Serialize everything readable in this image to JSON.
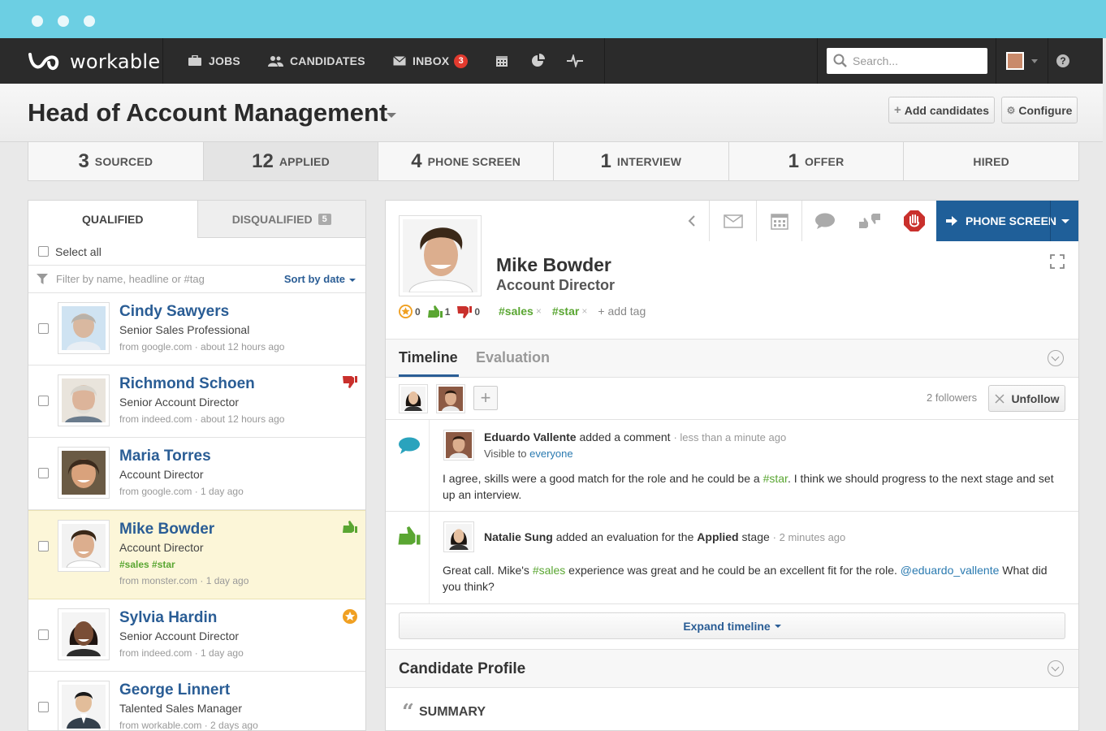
{
  "app": {
    "logo_text": "workable"
  },
  "nav": {
    "jobs": "JOBS",
    "candidates": "CANDIDATES",
    "inbox": "INBOX",
    "inbox_count": "3",
    "search_placeholder": "Search...",
    "help": "?"
  },
  "header": {
    "title": "Head of Account Management",
    "add_candidates": "Add candidates",
    "configure": "Configure"
  },
  "stages": [
    {
      "count": "3",
      "label": "SOURCED"
    },
    {
      "count": "12",
      "label": "APPLIED"
    },
    {
      "count": "4",
      "label": "PHONE SCREEN"
    },
    {
      "count": "1",
      "label": "INTERVIEW"
    },
    {
      "count": "1",
      "label": "OFFER"
    },
    {
      "count": "",
      "label": "HIRED"
    }
  ],
  "list": {
    "tab_qualified": "QUALIFIED",
    "tab_disqualified": "DISQUALIFIED",
    "disqualified_count": "5",
    "select_all": "Select all",
    "filter_placeholder": "Filter by name, headline or #tag",
    "sort": "Sort by date",
    "candidates": [
      {
        "name": "Cindy Sawyers",
        "role": "Senior Sales Professional",
        "meta": "from google.com · about 12 hours ago"
      },
      {
        "name": "Richmond Schoen",
        "role": "Senior Account Director",
        "meta": "from indeed.com · about 12 hours ago"
      },
      {
        "name": "Maria Torres",
        "role": "Account Director",
        "meta": "from google.com · 1 day ago"
      },
      {
        "name": "Mike Bowder",
        "role": "Account Director",
        "tags": "#sales  #star",
        "meta": "from monster.com · 1 day ago"
      },
      {
        "name": "Sylvia Hardin",
        "role": "Senior Account Director",
        "meta": "from indeed.com · 1 day ago"
      },
      {
        "name": "George Linnert",
        "role": "Talented Sales Manager",
        "meta": "from workable.com · 2 days ago"
      }
    ]
  },
  "profile": {
    "move_button": "PHONE SCREEN",
    "name": "Mike Bowder",
    "role": "Account Director",
    "stars": "0",
    "thumbs_up": "1",
    "thumbs_down": "0",
    "tag1": "#sales",
    "tag2": "#star",
    "add_tag": "add tag",
    "tab_timeline": "Timeline",
    "tab_evaluation": "Evaluation",
    "followers": "2 followers",
    "unfollow": "Unfollow",
    "events": [
      {
        "author": "Eduardo Vallente",
        "action": "added a comment",
        "time": "· less than a minute ago",
        "visible_prefix": "Visible to",
        "visible_to": "everyone",
        "body_1": "I agree, skills were a good match for the role and he could be a",
        "body_tag": "#star",
        "body_2": ". I think we should progress to the next stage and set up an interview."
      },
      {
        "author": "Natalie Sung",
        "action_1": "added an evaluation for the",
        "stage": "Applied",
        "action_2": "stage",
        "time": "· 2 minutes ago",
        "body_1": "Great call. Mike's",
        "body_tag": "#sales",
        "body_2": "experience was great and he could be an excellent fit for the role.",
        "mention": "@eduardo_vallente",
        "body_3": "What did you think?"
      }
    ],
    "expand_timeline": "Expand timeline",
    "candidate_profile": "Candidate Profile",
    "summary": "SUMMARY"
  },
  "colors": {
    "chrome": "#6ccfe3",
    "navbar": "#2b2b2b",
    "brand_blue": "#1f5f99",
    "tag_green": "#5aa632"
  }
}
